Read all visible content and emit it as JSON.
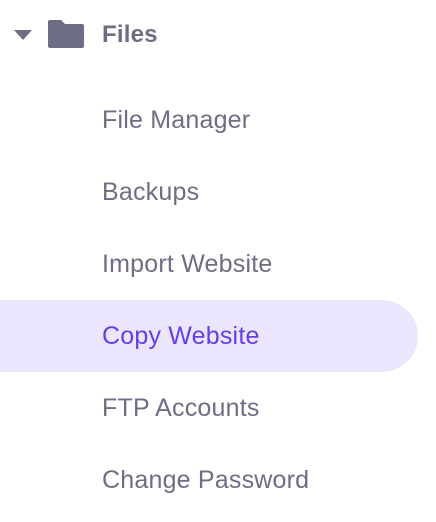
{
  "colors": {
    "text": "#6d6e85",
    "active_text": "#673de6",
    "active_bg": "#ebe6fd",
    "icon": "#6d6e85"
  },
  "section": {
    "title": "Files",
    "expanded": true,
    "toggle_icon": "caret-down-icon",
    "icon": "folder-icon"
  },
  "menu": {
    "items": [
      {
        "label": "File Manager",
        "active": false
      },
      {
        "label": "Backups",
        "active": false
      },
      {
        "label": "Import Website",
        "active": false
      },
      {
        "label": "Copy Website",
        "active": true
      },
      {
        "label": "FTP Accounts",
        "active": false
      },
      {
        "label": "Change Password",
        "active": false
      }
    ]
  }
}
